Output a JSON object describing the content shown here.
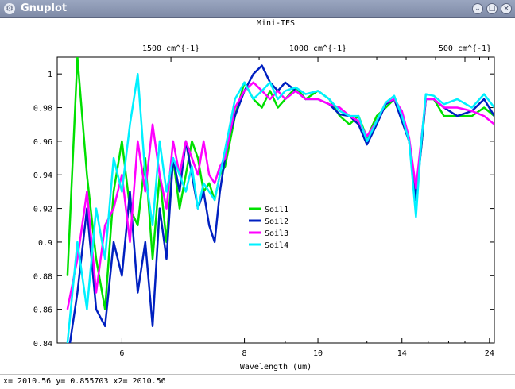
{
  "window": {
    "title": "Gnuplot",
    "icon": "gnuplot-app-icon",
    "buttons": [
      {
        "name": "minimize",
        "glyph": "⌄"
      },
      {
        "name": "maximize",
        "glyph": "□"
      },
      {
        "name": "close",
        "glyph": "×"
      }
    ]
  },
  "status": {
    "text": "x= 2010.56 y= 0.855703 x2= 2010.56"
  },
  "chart_data": {
    "type": "line",
    "title": "Mini-TES",
    "xlabel": "Wavelength (um)",
    "ylabel": "",
    "x_scale": "reciprocal",
    "xlim": [
      5.3,
      25
    ],
    "ylim": [
      0.84,
      1.01
    ],
    "x_ticks": [
      6,
      8,
      10,
      14,
      24
    ],
    "y_ticks": [
      0.84,
      0.86,
      0.88,
      0.9,
      0.92,
      0.94,
      0.96,
      0.98,
      1
    ],
    "x2_label": "cm^{-1}",
    "x2_ticks": [
      {
        "value": 1500,
        "label": "1500 cm^{-1}"
      },
      {
        "value": 1000,
        "label": "1000 cm^{-1}"
      },
      {
        "value": 500,
        "label": "500 cm^{-1}"
      }
    ],
    "legend_position": "center",
    "x": [
      5.4,
      5.5,
      5.6,
      5.7,
      5.8,
      5.9,
      6.0,
      6.1,
      6.2,
      6.3,
      6.4,
      6.5,
      6.6,
      6.7,
      6.8,
      6.9,
      7.0,
      7.1,
      7.2,
      7.3,
      7.4,
      7.5,
      7.6,
      7.7,
      7.8,
      8.0,
      8.2,
      8.4,
      8.6,
      8.8,
      9.0,
      9.3,
      9.6,
      10.0,
      10.4,
      10.8,
      11.2,
      11.6,
      12.0,
      12.5,
      13.0,
      13.5,
      14.0,
      14.5,
      15.0,
      15.4,
      15.8,
      16.5,
      17.5,
      19.0,
      21.0,
      23.0,
      25.0
    ],
    "series": [
      {
        "name": "Soil1",
        "color": "#00e000",
        "values": [
          0.88,
          1.01,
          0.94,
          0.89,
          0.86,
          0.93,
          0.96,
          0.92,
          0.91,
          0.95,
          0.89,
          0.94,
          0.9,
          0.95,
          0.92,
          0.94,
          0.96,
          0.95,
          0.93,
          0.935,
          0.925,
          0.94,
          0.945,
          0.96,
          0.975,
          0.995,
          0.985,
          0.98,
          0.99,
          0.98,
          0.985,
          0.992,
          0.985,
          0.99,
          0.985,
          0.975,
          0.97,
          0.975,
          0.962,
          0.975,
          0.98,
          0.985,
          0.975,
          0.96,
          0.93,
          0.955,
          0.985,
          0.985,
          0.975,
          0.975,
          0.975,
          0.98,
          0.975
        ]
      },
      {
        "name": "Soil2",
        "color": "#0020c0",
        "values": [
          0.83,
          0.87,
          0.92,
          0.86,
          0.85,
          0.9,
          0.88,
          0.93,
          0.87,
          0.9,
          0.85,
          0.92,
          0.89,
          0.95,
          0.93,
          0.96,
          0.94,
          0.92,
          0.93,
          0.91,
          0.9,
          0.93,
          0.95,
          0.965,
          0.975,
          0.99,
          1.0,
          1.005,
          0.995,
          0.99,
          0.995,
          0.99,
          0.985,
          0.985,
          0.982,
          0.976,
          0.975,
          0.97,
          0.958,
          0.97,
          0.982,
          0.985,
          0.972,
          0.96,
          0.925,
          0.955,
          0.985,
          0.985,
          0.98,
          0.975,
          0.978,
          0.985,
          0.975
        ]
      },
      {
        "name": "Soil3",
        "color": "#ff00ff",
        "values": [
          0.86,
          0.89,
          0.93,
          0.87,
          0.91,
          0.92,
          0.94,
          0.9,
          0.96,
          0.93,
          0.97,
          0.94,
          0.92,
          0.96,
          0.94,
          0.96,
          0.95,
          0.94,
          0.96,
          0.94,
          0.935,
          0.945,
          0.95,
          0.965,
          0.98,
          0.99,
          0.995,
          0.99,
          0.985,
          0.99,
          0.985,
          0.99,
          0.985,
          0.985,
          0.982,
          0.98,
          0.975,
          0.972,
          0.963,
          0.972,
          0.983,
          0.985,
          0.978,
          0.962,
          0.932,
          0.96,
          0.985,
          0.985,
          0.98,
          0.98,
          0.978,
          0.975,
          0.97
        ]
      },
      {
        "name": "Soil4",
        "color": "#00f0ff",
        "values": [
          0.84,
          0.9,
          0.86,
          0.92,
          0.89,
          0.95,
          0.93,
          0.97,
          1.0,
          0.94,
          0.91,
          0.96,
          0.93,
          0.95,
          0.94,
          0.93,
          0.945,
          0.92,
          0.935,
          0.93,
          0.925,
          0.94,
          0.955,
          0.97,
          0.985,
          0.995,
          0.985,
          0.99,
          0.995,
          0.985,
          0.99,
          0.992,
          0.988,
          0.99,
          0.985,
          0.978,
          0.975,
          0.975,
          0.96,
          0.972,
          0.983,
          0.987,
          0.975,
          0.96,
          0.915,
          0.958,
          0.988,
          0.987,
          0.982,
          0.985,
          0.98,
          0.988,
          0.98
        ]
      }
    ]
  }
}
